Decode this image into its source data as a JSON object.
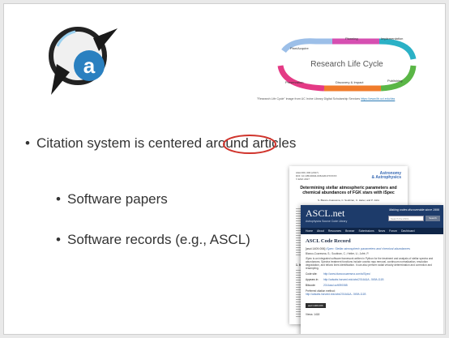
{
  "slide": {
    "bullets": {
      "main_text": "Citation system is centered around ",
      "main_highlight": "articles",
      "sub1": "Software papers",
      "sub2": "Software records (e.g., ASCL)"
    },
    "bullet_symbol": "•",
    "colors": {
      "text": "#333333",
      "circle": "#d0342c",
      "logo_blue": "#2a80c0",
      "logo_dark": "#222222"
    },
    "logo_icon": "ads-magnifier-icon",
    "logo_letter": "a"
  },
  "lifecycle": {
    "center_title": "Research Life Cycle",
    "stages": [
      "Plan/Acquire",
      "Planning",
      "Implementation",
      "Publishing",
      "Discovery & Impact",
      "Preservation"
    ],
    "caption": "\"Research Life Cycle\" image from UC Irvine Library Digital Scholarship Services",
    "caption_link": "https://www.lib.uci.edu/dss"
  },
  "paper": {
    "header": "A&A 000, 000 (2017)\nDOI: 10.1051/0004-6361/2017XXXXX\n© ESO 2017",
    "journal": "Astronomy\n& Astrophysics",
    "title": "Determining stellar atmospheric parameters and chemical abundances of FGK stars with iSpec",
    "authors": "S. Blanco-Cuaresma, C. Soubiran, U. Heiter, and P. Jofré",
    "section": "1. Introduction"
  },
  "ascl": {
    "site_title": "ASCL.net",
    "subtitle": "Astrophysics Source Code Library",
    "tagline": "Making codes discoverable since 1999",
    "search_placeholder": "Search the ASCL",
    "search_button": "Search",
    "nav": [
      "Home",
      "About",
      "Resources",
      "Browse",
      "Submissions",
      "News",
      "Forum",
      "Dashboard"
    ],
    "record_heading": "ASCL Code Record",
    "record_id": "[ascl:1409.006]",
    "record_title": "iSpec: Stellar atmospheric parameters and chemical abundances",
    "record_authors": "Blanco-Cuaresma, S.; Soubiran, C.; Heiter, U.; Jofré, P.",
    "description": "iSpec is an integrated software framework written in Python for the treatment and analysis of stellar spectra and abundances. Spectra treatment functions include cosmic rays removal, continuum normalization, resolution degradation, and telluric lines identification. It can also perform radial velocity determination and correction and resampling.",
    "rows": [
      {
        "key": "Code site:",
        "value": "http://www.blancocuaresma.com/s/iSpec/"
      },
      {
        "key": "Appears in:",
        "value": "http://adsabs.harvard.edu/abs/2014A&A...569A.111B"
      },
      {
        "key": "Bibcode:",
        "value": "2014ascl.soft09006B"
      }
    ],
    "preferred_label": "Preferred citation method:",
    "preferred_value": "http://adsabs.harvard.edu/abs/2014A&A...569A.111B",
    "button_label": "ascl:1409.006",
    "views_label": "Views: 1418"
  }
}
